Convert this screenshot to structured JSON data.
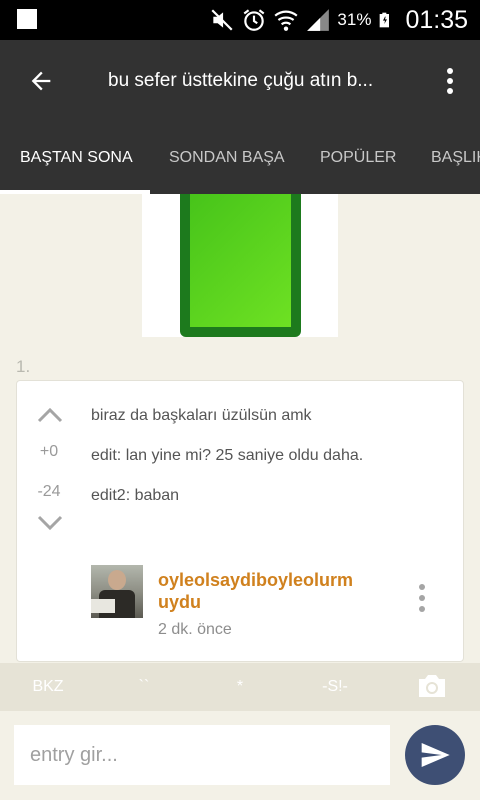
{
  "status_bar": {
    "battery_percent": "31%",
    "time": "01:35",
    "icons": [
      "notification-square-icon",
      "mute-icon",
      "alarm-icon",
      "wifi-icon",
      "signal-icon",
      "battery-icon"
    ]
  },
  "toolbar": {
    "title": "bu sefer üsttekine çuğu atın b...",
    "back_icon": "arrow-left-icon",
    "more_icon": "more-vertical-icon"
  },
  "tabs": [
    {
      "label": "BAŞTAN SONA",
      "active": true
    },
    {
      "label": "SONDAN BAŞA",
      "active": false
    },
    {
      "label": "POPÜLER",
      "active": false
    },
    {
      "label": "BAŞLIK",
      "active": false
    }
  ],
  "entry": {
    "index": "1.",
    "upvote": "+0",
    "downvote": "-24",
    "lines": [
      "biraz da başkaları üzülsün amk",
      "edit: lan yine mi? 25 saniye oldu daha.",
      "edit2: baban"
    ],
    "author_line1": "oyleolsaydiboyleolurm",
    "author_line2": "uydu",
    "time": "2 dk. önce"
  },
  "bottom_toolbar": {
    "bkz": "BKZ",
    "quote": "``",
    "star": "*",
    "spoiler": "-S!-",
    "camera_icon": "camera-icon"
  },
  "input": {
    "placeholder": "entry gir...",
    "send_icon": "send-icon"
  },
  "colors": {
    "header_bg": "#323232",
    "page_bg": "#f3f1e7",
    "author": "#d0811e",
    "send_button": "#3e4f74"
  }
}
